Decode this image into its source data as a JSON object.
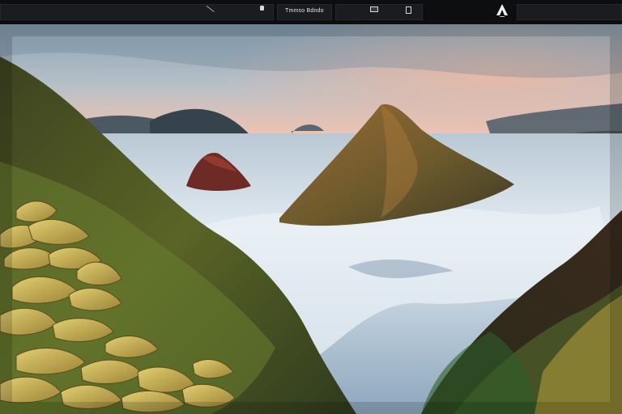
{
  "toolbar": {
    "title": "Tmmso  Bdndo",
    "icons": {
      "pencil": "pencil-icon",
      "doc": "document-icon",
      "image": "image-icon",
      "book": "bookmark-icon",
      "logo": "app-logo-icon"
    }
  },
  "colors": {
    "chrome": "#0d0e10",
    "segment": "#1b1c20",
    "sea": "#dfe8ef",
    "sky_top": "#88a4b8",
    "sky_glow": "#e6b2a3",
    "moss": "#5b6a2a",
    "stone": "#c9b155"
  }
}
